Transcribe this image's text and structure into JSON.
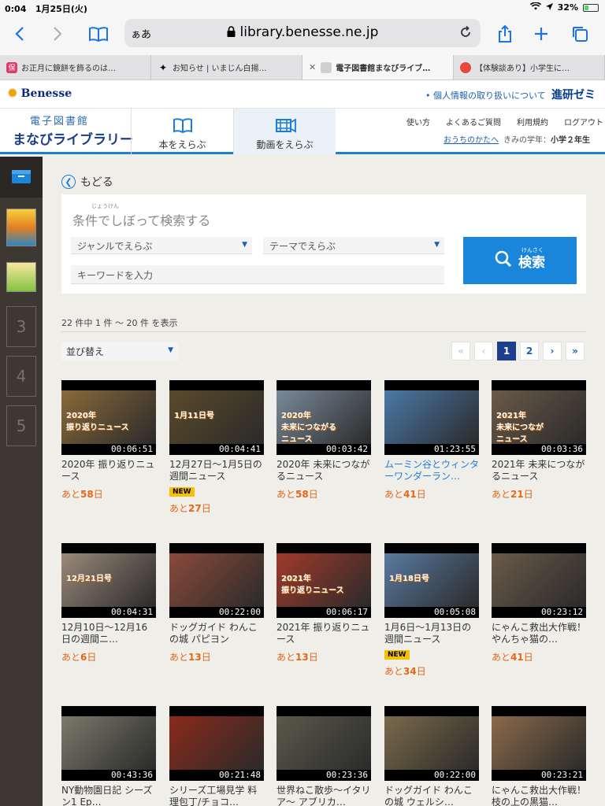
{
  "status": {
    "time": "0:04",
    "date": "1月25日(火)",
    "battery": "32%",
    "battery_level": 0.32
  },
  "browser": {
    "aa": "ぁあ",
    "url": "library.benesse.ne.jp",
    "tabs": [
      {
        "title": "お正月に鏡餅を飾るのは…",
        "fav": "保",
        "color": "#e03c6e"
      },
      {
        "title": "お知らせ | いまじん白揚…",
        "fav": "✦",
        "color": "#ffffff"
      },
      {
        "title": "電子図書館まなびライブ…",
        "fav": "",
        "color": "#cfcfcf",
        "active": true
      },
      {
        "title": "【体験談あり】小学生に…",
        "fav": "",
        "color": "#e8473c"
      }
    ]
  },
  "site": {
    "brand": "Benesse",
    "privacy_link": "• 個人情報の取り扱いについて",
    "zemi": "進研ゼミ",
    "logo_line1": "電子図書館",
    "logo_line2": "まなびライブラリー",
    "nav_books": "本をえらぶ",
    "nav_videos": "動画をえらぶ",
    "links": [
      "使い方",
      "よくあるご質問",
      "利用規約",
      "ログアウト"
    ],
    "parent_link": "おうちのかたへ",
    "grade_label": "きみの学年：",
    "grade": "小学２年生"
  },
  "sidebar": {
    "slots": [
      "3",
      "4",
      "5"
    ]
  },
  "main": {
    "back": "もどる",
    "search_title_ruby": "じょうけん",
    "search_title": "条件でしぼって検索する",
    "genre_select": "ジャンルでえらぶ",
    "theme_select": "テーマでえらぶ",
    "keyword_placeholder": "キーワードを入力",
    "search_ruby": "けんさく",
    "search_button": "検索",
    "count_text": "22 件中  1 件 ～  20 件 を表示",
    "sort_label": "並び替え",
    "pager": [
      "«",
      "‹",
      "1",
      "2",
      "›",
      "»"
    ]
  },
  "videos": [
    {
      "title": "2020年 振り返りニュース",
      "duration": "00:06:51",
      "remain_prefix": "あと",
      "remain_days": "58",
      "remain_suffix": "日",
      "new": false,
      "blue": false,
      "overlay": "2020年\n振り返りニュース",
      "bg": "#8a6a3a"
    },
    {
      "title": "12月27日〜1月5日の週間ニュース",
      "duration": "00:04:41",
      "remain_prefix": "あと",
      "remain_days": "27",
      "remain_suffix": "日",
      "new": true,
      "blue": false,
      "overlay": "1月11日号",
      "bg": "#5a4a2a"
    },
    {
      "title": "2020年 未来につながるニュース",
      "duration": "00:03:42",
      "remain_prefix": "あと",
      "remain_days": "58",
      "remain_suffix": "日",
      "new": false,
      "blue": false,
      "overlay": "2020年\n未来につながる\nニュース",
      "bg": "#7a8a9a"
    },
    {
      "title": "ムーミン谷とウィンターワンダーラン…",
      "duration": "01:23:55",
      "remain_prefix": "あと",
      "remain_days": "41",
      "remain_suffix": "日",
      "new": false,
      "blue": true,
      "overlay": "",
      "bg": "#4a7aa8"
    },
    {
      "title": "2021年 未来につながるニュース",
      "duration": "00:03:36",
      "remain_prefix": "あと",
      "remain_days": "21",
      "remain_suffix": "日",
      "new": false,
      "blue": false,
      "overlay": "2021年\n未来につなが\nニュース",
      "bg": "#6a5a4a"
    },
    {
      "title": "12月10日〜12月16日の週間ニ…",
      "duration": "00:04:31",
      "remain_prefix": "あと",
      "remain_days": "6",
      "remain_suffix": "日",
      "new": false,
      "blue": false,
      "overlay": "12月21日号",
      "bg": "#9a8a7a"
    },
    {
      "title": "ドッグガイド わんこの城 パピヨン",
      "duration": "00:22:00",
      "remain_prefix": "あと",
      "remain_days": "13",
      "remain_suffix": "日",
      "new": false,
      "blue": false,
      "overlay": "",
      "bg": "#8a4a3a"
    },
    {
      "title": "2021年 振り返りニュース",
      "duration": "00:06:17",
      "remain_prefix": "あと",
      "remain_days": "13",
      "remain_suffix": "日",
      "new": false,
      "blue": false,
      "overlay": "2021年\n振り返りニュース",
      "bg": "#a03a2a"
    },
    {
      "title": "1月6日〜1月13日の週間ニュース",
      "duration": "00:05:08",
      "remain_prefix": "あと",
      "remain_days": "34",
      "remain_suffix": "日",
      "new": true,
      "blue": false,
      "overlay": "1月18日号",
      "bg": "#5a7aa0"
    },
    {
      "title": "にゃんこ救出大作戦！やんちゃ猫の…",
      "duration": "00:23:12",
      "remain_prefix": "あと",
      "remain_days": "41",
      "remain_suffix": "日",
      "new": false,
      "blue": false,
      "overlay": "",
      "bg": "#6a5a4a"
    },
    {
      "title": "NY動物園日記 シーズン1 Ep…",
      "duration": "00:43:36",
      "remain_prefix": "",
      "remain_days": "",
      "remain_suffix": "",
      "new": false,
      "blue": false,
      "overlay": "",
      "bg": "#7a7a6a"
    },
    {
      "title": "シリーズ工場見学 料理包丁/チョコ…",
      "duration": "00:21:48",
      "remain_prefix": "",
      "remain_days": "",
      "remain_suffix": "",
      "new": false,
      "blue": false,
      "overlay": "",
      "bg": "#8a2a1a"
    },
    {
      "title": "世界ねこ散歩〜イタリア〜 アブリカ…",
      "duration": "00:23:36",
      "remain_prefix": "",
      "remain_days": "",
      "remain_suffix": "",
      "new": false,
      "blue": false,
      "overlay": "",
      "bg": "#5a5a4a"
    },
    {
      "title": "ドッグガイド わんこの城 ウェルシ…",
      "duration": "00:22:00",
      "remain_prefix": "",
      "remain_days": "",
      "remain_suffix": "",
      "new": false,
      "blue": false,
      "overlay": "",
      "bg": "#7a6a4a"
    },
    {
      "title": "にゃんこ救出大作戦！枝の上の黒猫…",
      "duration": "00:23:21",
      "remain_prefix": "",
      "remain_days": "",
      "remain_suffix": "",
      "new": false,
      "blue": false,
      "overlay": "",
      "bg": "#8a6a4a"
    }
  ]
}
